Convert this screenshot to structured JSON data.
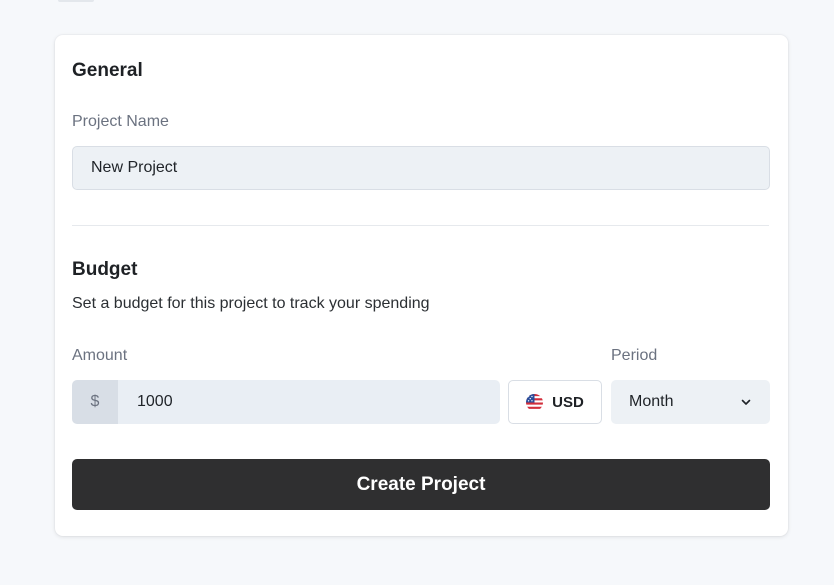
{
  "general": {
    "title": "General",
    "project_name_label": "Project Name",
    "project_name_value": "New Project"
  },
  "budget": {
    "title": "Budget",
    "subtitle": "Set a budget for this project to track your spending",
    "amount_label": "Amount",
    "currency_symbol": "$",
    "amount_value": "1000",
    "currency": {
      "code": "USD",
      "icon": "us-flag-icon"
    },
    "period_label": "Period",
    "period_value": "Month",
    "period_icon": "chevron-down-icon"
  },
  "actions": {
    "create_label": "Create Project"
  },
  "colors": {
    "primary_button": "#2f2f30",
    "input_background": "#edf1f5",
    "page_background": "#f6f8fb"
  }
}
